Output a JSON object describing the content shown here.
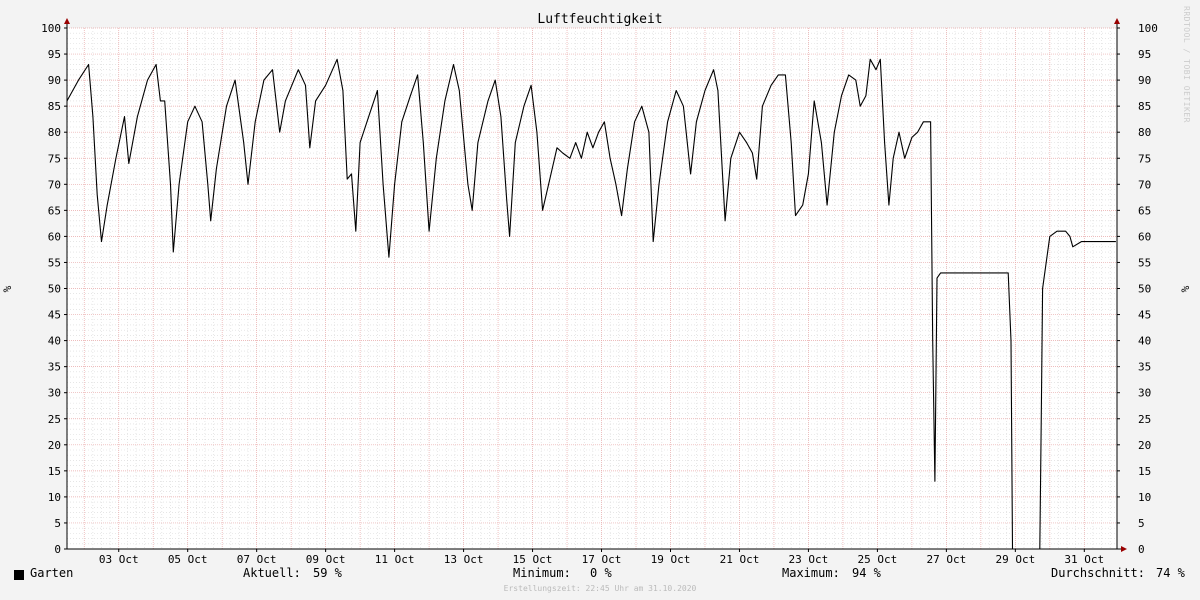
{
  "chart_data": {
    "type": "line",
    "title": "Luftfeuchtigkeit",
    "ylabel": "%",
    "ylim": [
      0,
      100
    ],
    "yticks": [
      0,
      5,
      10,
      15,
      20,
      25,
      30,
      35,
      40,
      45,
      50,
      55,
      60,
      65,
      70,
      75,
      80,
      85,
      90,
      95,
      100
    ],
    "xlim": [
      "2020-10-01T12:00",
      "2020-10-31T22:45"
    ],
    "xtick_labels": [
      "03 Oct",
      "05 Oct",
      "07 Oct",
      "09 Oct",
      "11 Oct",
      "13 Oct",
      "15 Oct",
      "17 Oct",
      "19 Oct",
      "21 Oct",
      "23 Oct",
      "25 Oct",
      "27 Oct",
      "29 Oct",
      "31 Oct"
    ],
    "grid": true,
    "series": [
      {
        "name": "Garten",
        "color": "#000000",
        "points": [
          [
            "2020-10-01T12:00",
            86
          ],
          [
            "2020-10-01T20:00",
            90
          ],
          [
            "2020-10-02T03:00",
            93
          ],
          [
            "2020-10-02T06:00",
            83
          ],
          [
            "2020-10-02T09:00",
            68
          ],
          [
            "2020-10-02T12:00",
            59
          ],
          [
            "2020-10-02T16:00",
            66
          ],
          [
            "2020-10-02T22:00",
            75
          ],
          [
            "2020-10-03T04:00",
            83
          ],
          [
            "2020-10-03T07:00",
            74
          ],
          [
            "2020-10-03T13:00",
            83
          ],
          [
            "2020-10-03T20:00",
            90
          ],
          [
            "2020-10-04T02:00",
            93
          ],
          [
            "2020-10-04T05:00",
            86
          ],
          [
            "2020-10-04T08:00",
            86
          ],
          [
            "2020-10-04T12:00",
            70
          ],
          [
            "2020-10-04T14:00",
            57
          ],
          [
            "2020-10-04T18:00",
            70
          ],
          [
            "2020-10-05T00:00",
            82
          ],
          [
            "2020-10-05T05:00",
            85
          ],
          [
            "2020-10-05T10:00",
            82
          ],
          [
            "2020-10-05T14:00",
            70
          ],
          [
            "2020-10-05T16:00",
            63
          ],
          [
            "2020-10-05T20:00",
            73
          ],
          [
            "2020-10-06T03:00",
            85
          ],
          [
            "2020-10-06T09:00",
            90
          ],
          [
            "2020-10-06T15:00",
            78
          ],
          [
            "2020-10-06T18:00",
            70
          ],
          [
            "2020-10-06T23:00",
            82
          ],
          [
            "2020-10-07T05:00",
            90
          ],
          [
            "2020-10-07T11:00",
            92
          ],
          [
            "2020-10-07T16:00",
            80
          ],
          [
            "2020-10-07T20:00",
            86
          ],
          [
            "2020-10-08T05:00",
            92
          ],
          [
            "2020-10-08T10:00",
            89
          ],
          [
            "2020-10-08T13:00",
            77
          ],
          [
            "2020-10-08T17:00",
            86
          ],
          [
            "2020-10-09T00:00",
            89
          ],
          [
            "2020-10-09T08:00",
            94
          ],
          [
            "2020-10-09T12:00",
            88
          ],
          [
            "2020-10-09T15:00",
            71
          ],
          [
            "2020-10-09T18:00",
            72
          ],
          [
            "2020-10-09T21:00",
            61
          ],
          [
            "2020-10-10T00:00",
            78
          ],
          [
            "2020-10-10T06:00",
            83
          ],
          [
            "2020-10-10T12:00",
            88
          ],
          [
            "2020-10-10T16:00",
            70
          ],
          [
            "2020-10-10T20:00",
            56
          ],
          [
            "2020-10-11T00:00",
            70
          ],
          [
            "2020-10-11T05:00",
            82
          ],
          [
            "2020-10-11T11:00",
            87
          ],
          [
            "2020-10-11T16:00",
            91
          ],
          [
            "2020-10-11T20:00",
            78
          ],
          [
            "2020-10-12T00:00",
            61
          ],
          [
            "2020-10-12T05:00",
            75
          ],
          [
            "2020-10-12T11:00",
            86
          ],
          [
            "2020-10-12T17:00",
            93
          ],
          [
            "2020-10-12T21:00",
            88
          ],
          [
            "2020-10-13T03:00",
            70
          ],
          [
            "2020-10-13T06:00",
            65
          ],
          [
            "2020-10-13T10:00",
            78
          ],
          [
            "2020-10-13T17:00",
            86
          ],
          [
            "2020-10-13T22:00",
            90
          ],
          [
            "2020-10-14T02:00",
            83
          ],
          [
            "2020-10-14T06:00",
            67
          ],
          [
            "2020-10-14T08:00",
            60
          ],
          [
            "2020-10-14T12:00",
            78
          ],
          [
            "2020-10-14T18:00",
            85
          ],
          [
            "2020-10-14T23:00",
            89
          ],
          [
            "2020-10-15T03:00",
            80
          ],
          [
            "2020-10-15T07:00",
            65
          ],
          [
            "2020-10-15T12:00",
            71
          ],
          [
            "2020-10-15T17:00",
            77
          ],
          [
            "2020-10-15T21:00",
            76
          ],
          [
            "2020-10-16T02:00",
            75
          ],
          [
            "2020-10-16T06:00",
            78
          ],
          [
            "2020-10-16T10:00",
            75
          ],
          [
            "2020-10-16T14:00",
            80
          ],
          [
            "2020-10-16T18:00",
            77
          ],
          [
            "2020-10-16T22:00",
            80
          ],
          [
            "2020-10-17T02:00",
            82
          ],
          [
            "2020-10-17T06:00",
            75
          ],
          [
            "2020-10-17T10:00",
            70
          ],
          [
            "2020-10-17T14:00",
            64
          ],
          [
            "2020-10-17T18:00",
            73
          ],
          [
            "2020-10-17T23:00",
            82
          ],
          [
            "2020-10-18T04:00",
            85
          ],
          [
            "2020-10-18T09:00",
            80
          ],
          [
            "2020-10-18T12:00",
            59
          ],
          [
            "2020-10-18T16:00",
            70
          ],
          [
            "2020-10-18T22:00",
            82
          ],
          [
            "2020-10-19T04:00",
            88
          ],
          [
            "2020-10-19T09:00",
            85
          ],
          [
            "2020-10-19T14:00",
            72
          ],
          [
            "2020-10-19T18:00",
            82
          ],
          [
            "2020-10-20T00:00",
            88
          ],
          [
            "2020-10-20T06:00",
            92
          ],
          [
            "2020-10-20T09:00",
            88
          ],
          [
            "2020-10-20T12:00",
            73
          ],
          [
            "2020-10-20T14:00",
            63
          ],
          [
            "2020-10-20T18:00",
            75
          ],
          [
            "2020-10-21T00:00",
            80
          ],
          [
            "2020-10-21T05:00",
            78
          ],
          [
            "2020-10-21T09:00",
            76
          ],
          [
            "2020-10-21T12:00",
            71
          ],
          [
            "2020-10-21T16:00",
            85
          ],
          [
            "2020-10-21T22:00",
            89
          ],
          [
            "2020-10-22T03:00",
            91
          ],
          [
            "2020-10-22T08:00",
            91
          ],
          [
            "2020-10-22T12:00",
            78
          ],
          [
            "2020-10-22T15:00",
            64
          ],
          [
            "2020-10-22T20:00",
            66
          ],
          [
            "2020-10-23T00:00",
            72
          ],
          [
            "2020-10-23T04:00",
            86
          ],
          [
            "2020-10-23T09:00",
            78
          ],
          [
            "2020-10-23T13:00",
            66
          ],
          [
            "2020-10-23T18:00",
            80
          ],
          [
            "2020-10-23T23:00",
            87
          ],
          [
            "2020-10-24T04:00",
            91
          ],
          [
            "2020-10-24T09:00",
            90
          ],
          [
            "2020-10-24T12:00",
            85
          ],
          [
            "2020-10-24T16:00",
            87
          ],
          [
            "2020-10-24T19:00",
            94
          ],
          [
            "2020-10-24T23:00",
            92
          ],
          [
            "2020-10-25T02:00",
            94
          ],
          [
            "2020-10-25T05:00",
            78
          ],
          [
            "2020-10-25T08:00",
            66
          ],
          [
            "2020-10-25T11:00",
            75
          ],
          [
            "2020-10-25T15:00",
            80
          ],
          [
            "2020-10-25T19:00",
            75
          ],
          [
            "2020-10-26T00:00",
            79
          ],
          [
            "2020-10-26T04:00",
            80
          ],
          [
            "2020-10-26T08:00",
            82
          ],
          [
            "2020-10-26T11:00",
            82
          ],
          [
            "2020-10-26T13:00",
            82
          ],
          [
            "2020-10-26T14:30",
            40
          ],
          [
            "2020-10-26T16:00",
            13
          ],
          [
            "2020-10-26T17:30",
            52
          ],
          [
            "2020-10-26T20:00",
            53
          ],
          [
            "2020-10-27T12:00",
            53
          ],
          [
            "2020-10-28T12:00",
            53
          ],
          [
            "2020-10-28T19:00",
            53
          ],
          [
            "2020-10-28T21:00",
            40
          ],
          [
            "2020-10-28T22:00",
            0
          ],
          [
            "2020-10-29T12:00",
            0
          ],
          [
            "2020-10-29T17:00",
            0
          ],
          [
            "2020-10-29T18:00",
            24
          ],
          [
            "2020-10-29T19:00",
            50
          ],
          [
            "2020-10-30T00:00",
            60
          ],
          [
            "2020-10-30T05:00",
            61
          ],
          [
            "2020-10-30T11:00",
            61
          ],
          [
            "2020-10-30T14:00",
            60
          ],
          [
            "2020-10-30T16:00",
            58
          ],
          [
            "2020-10-30T22:00",
            59
          ],
          [
            "2020-10-31T12:00",
            59
          ],
          [
            "2020-10-31T22:00",
            59
          ]
        ]
      }
    ]
  },
  "legend": {
    "series_name": "Garten",
    "current_label": "Aktuell:",
    "current_value": "59 %",
    "min_label": "Minimum:",
    "min_value": "0 %",
    "max_label": "Maximum:",
    "max_value": "94 %",
    "avg_label": "Durchschnitt:",
    "avg_value": "74 %"
  },
  "footer": "Erstellungszeit: 22:45 Uhr am 31.10.2020",
  "watermark": "RRDTOOL / TOBI OETIKER",
  "colors": {
    "background": "#f3f3f3",
    "plot_background": "#ffffff",
    "major_grid": "#e8a7a7",
    "minor_grid": "#d8d8d8",
    "line": "#000000",
    "arrow": "#990000"
  }
}
